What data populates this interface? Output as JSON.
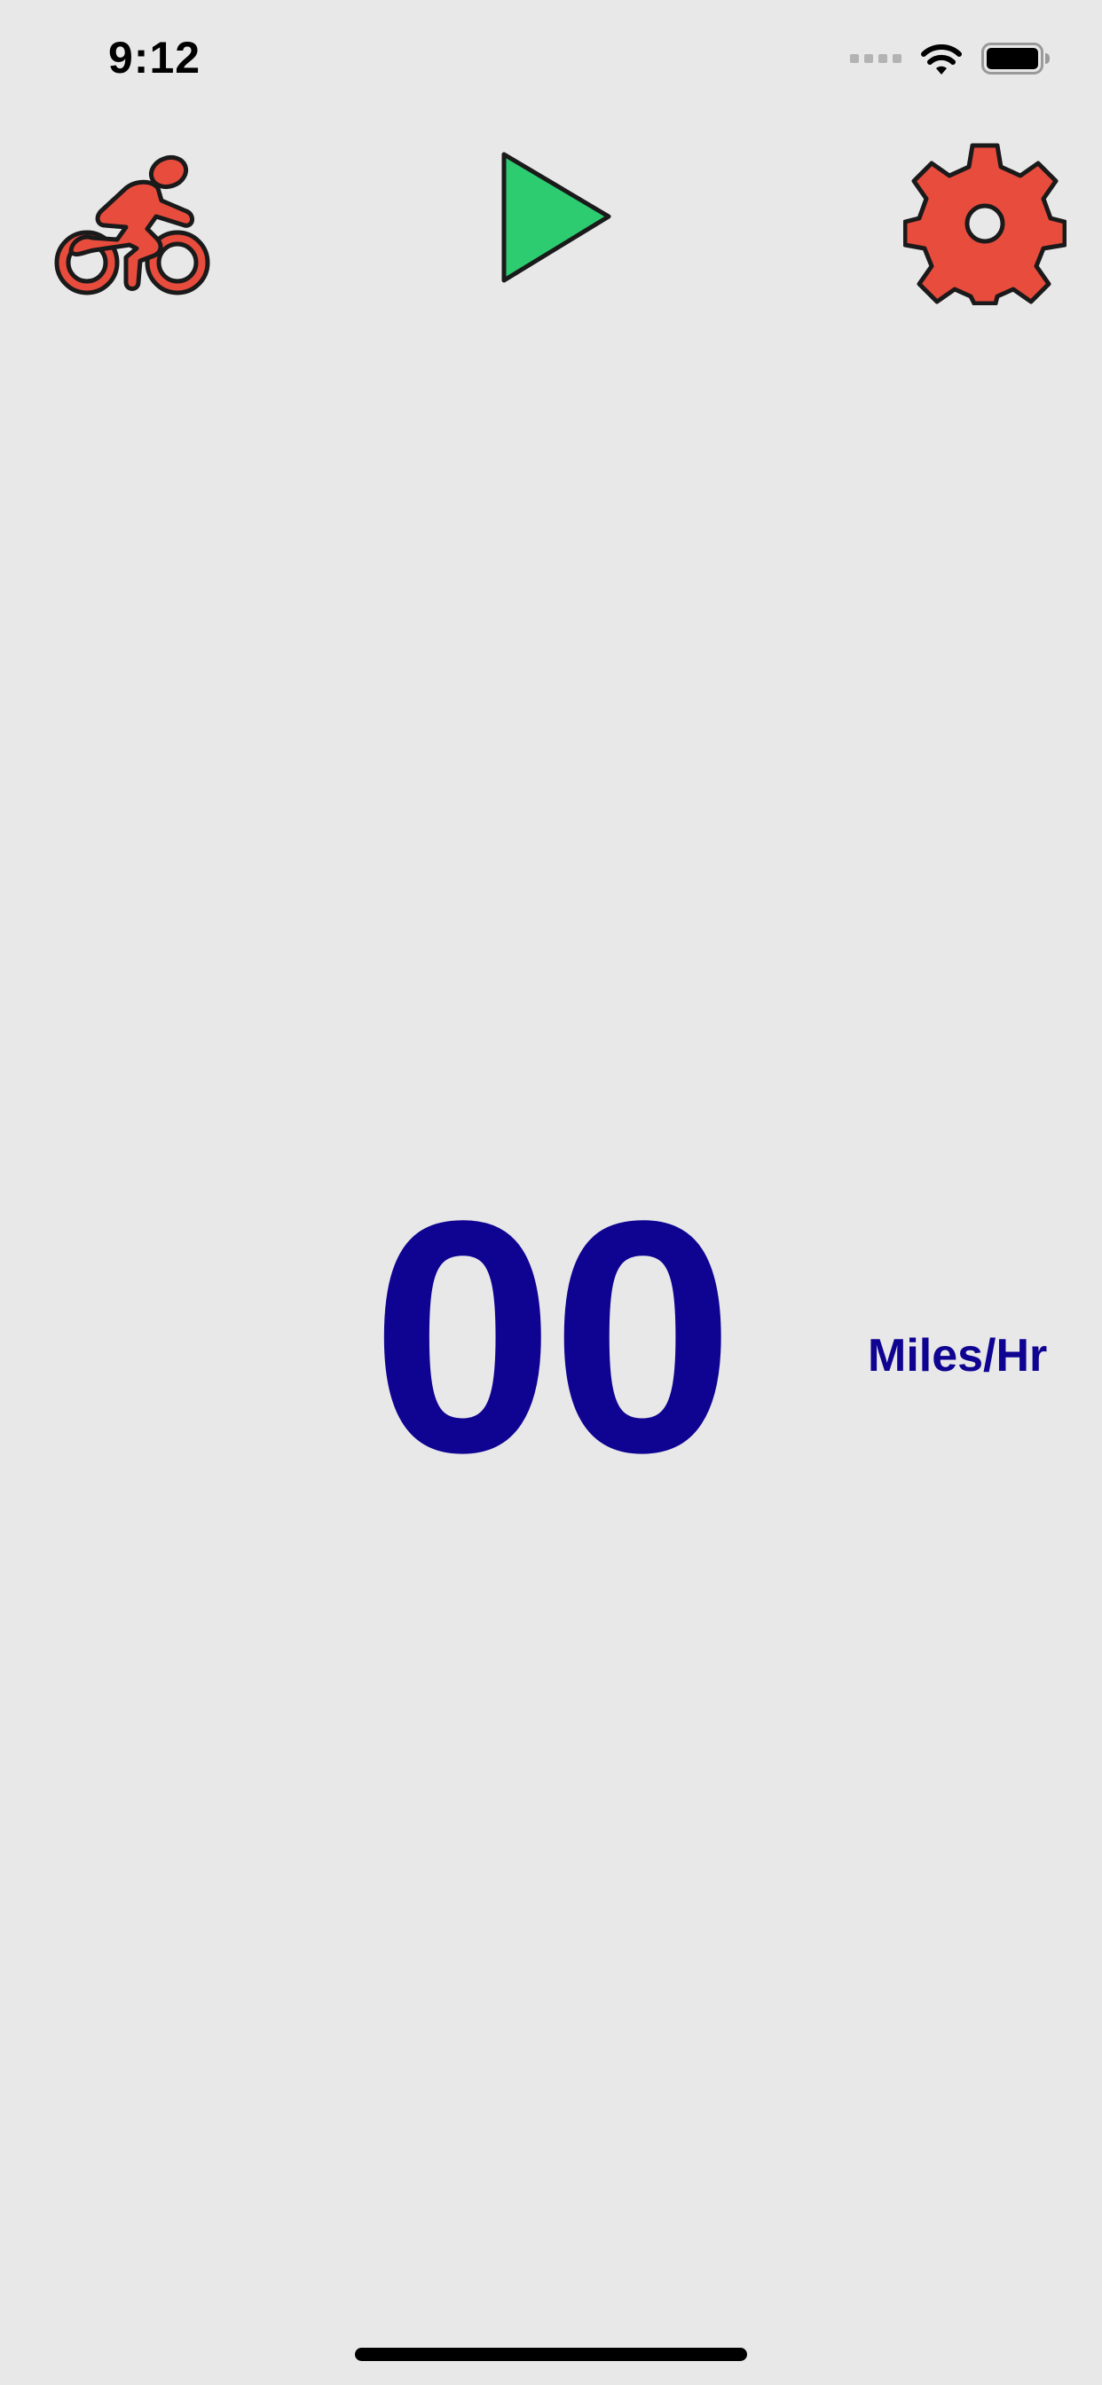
{
  "status_bar": {
    "time": "9:12",
    "icons": [
      "cellular-signal-icon",
      "wifi-icon",
      "battery-icon"
    ]
  },
  "toolbar": {
    "bike_icon": "bicycle-rider-icon",
    "play_icon": "play-icon",
    "settings_icon": "gear-icon"
  },
  "speed": {
    "value": "00",
    "unit": "Miles/Hr"
  },
  "colors": {
    "background": "#e8e8e8",
    "speed_text": "#0f0392",
    "icon_red": "#e84c3d",
    "play_green": "#2ecc71"
  }
}
